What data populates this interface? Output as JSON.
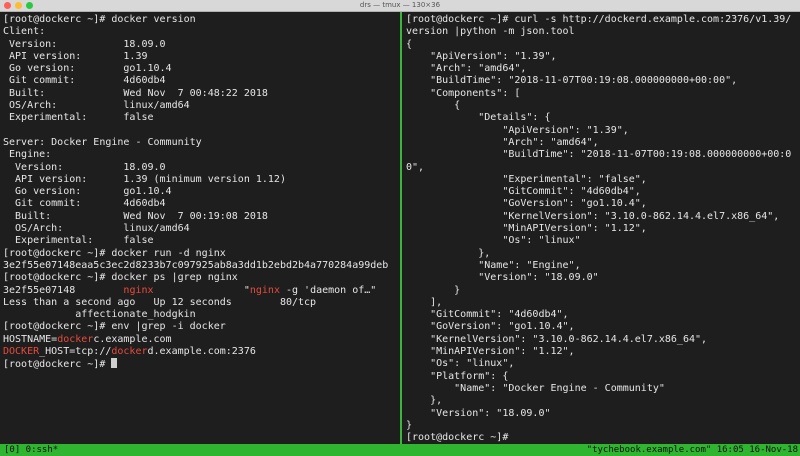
{
  "window": {
    "title": "drs — tmux — 130×36",
    "colors": {
      "close": "#ff5f57",
      "minimize": "#febc2e",
      "zoom": "#28c840",
      "accent": "#2fb52f",
      "highlight": "#e64b3c"
    }
  },
  "left_pane": {
    "l0": "[root@dockerc ~]# docker version",
    "l1": "Client:",
    "l2": " Version:           18.09.0",
    "l3": " API version:       1.39",
    "l4": " Go version:        go1.10.4",
    "l5": " Git commit:        4d60db4",
    "l6": " Built:             Wed Nov  7 00:48:22 2018",
    "l7": " OS/Arch:           linux/amd64",
    "l8": " Experimental:      false",
    "l9": "",
    "l10": "Server: Docker Engine - Community",
    "l11": " Engine:",
    "l12": "  Version:          18.09.0",
    "l13": "  API version:      1.39 (minimum version 1.12)",
    "l14": "  Go version:       go1.10.4",
    "l15": "  Git commit:       4d60db4",
    "l16": "  Built:            Wed Nov  7 00:19:08 2018",
    "l17": "  OS/Arch:          linux/amd64",
    "l18": "  Experimental:     false",
    "l19": "[root@dockerc ~]# docker run -d nginx",
    "l20": "3e2f55e07148eaa5c3ec2d8233b7c097925ab8a3dd1b2ebd2b4a770284a99deb",
    "l21": "[root@dockerc ~]# docker ps |grep nginx",
    "l22a": "3e2f55e07148        ",
    "l22b": "nginx",
    "l22c": "               \"",
    "l22d": "nginx",
    "l22e": " -g 'daemon of…\"",
    "l23": "Less than a second ago   Up 12 seconds        80/tcp",
    "l24": "            affectionate_hodgkin",
    "l25": "[root@dockerc ~]# env |grep -i docker",
    "l26a": "HOSTNAME=",
    "l26b": "docker",
    "l26c": "c.example.com",
    "l27a": "DOCKER",
    "l27b": "_HOST=tcp://",
    "l27c": "docker",
    "l27d": "d.example.com:2376",
    "l28": "[root@dockerc ~]# "
  },
  "right_pane": {
    "r0": "[root@dockerc ~]# curl -s http://dockerd.example.com:2376/v1.39/",
    "r1": "version |python -m json.tool",
    "r2": "{",
    "r3": "    \"ApiVersion\": \"1.39\",",
    "r4": "    \"Arch\": \"amd64\",",
    "r5": "    \"BuildTime\": \"2018-11-07T00:19:08.000000000+00:00\",",
    "r6": "    \"Components\": [",
    "r7": "        {",
    "r8": "            \"Details\": {",
    "r9": "                \"ApiVersion\": \"1.39\",",
    "r10": "                \"Arch\": \"amd64\",",
    "r11": "                \"BuildTime\": \"2018-11-07T00:19:08.000000000+00:0",
    "r12": "0\",",
    "r13": "                \"Experimental\": \"false\",",
    "r14": "                \"GitCommit\": \"4d60db4\",",
    "r15": "                \"GoVersion\": \"go1.10.4\",",
    "r16": "                \"KernelVersion\": \"3.10.0-862.14.4.el7.x86_64\",",
    "r17": "                \"MinAPIVersion\": \"1.12\",",
    "r18": "                \"Os\": \"linux\"",
    "r19": "            },",
    "r20": "            \"Name\": \"Engine\",",
    "r21": "            \"Version\": \"18.09.0\"",
    "r22": "        }",
    "r23": "    ],",
    "r24": "    \"GitCommit\": \"4d60db4\",",
    "r25": "    \"GoVersion\": \"go1.10.4\",",
    "r26": "    \"KernelVersion\": \"3.10.0-862.14.4.el7.x86_64\",",
    "r27": "    \"MinAPIVersion\": \"1.12\",",
    "r28": "    \"Os\": \"linux\",",
    "r29": "    \"Platform\": {",
    "r30": "        \"Name\": \"Docker Engine - Community\"",
    "r31": "    },",
    "r32": "    \"Version\": \"18.09.0\"",
    "r33": "}",
    "r34": "[root@dockerc ~]# "
  },
  "status_bar": {
    "left": "[0] 0:ssh*",
    "right": "\"tychebook.example.com\" 16:05 16-Nov-18"
  }
}
